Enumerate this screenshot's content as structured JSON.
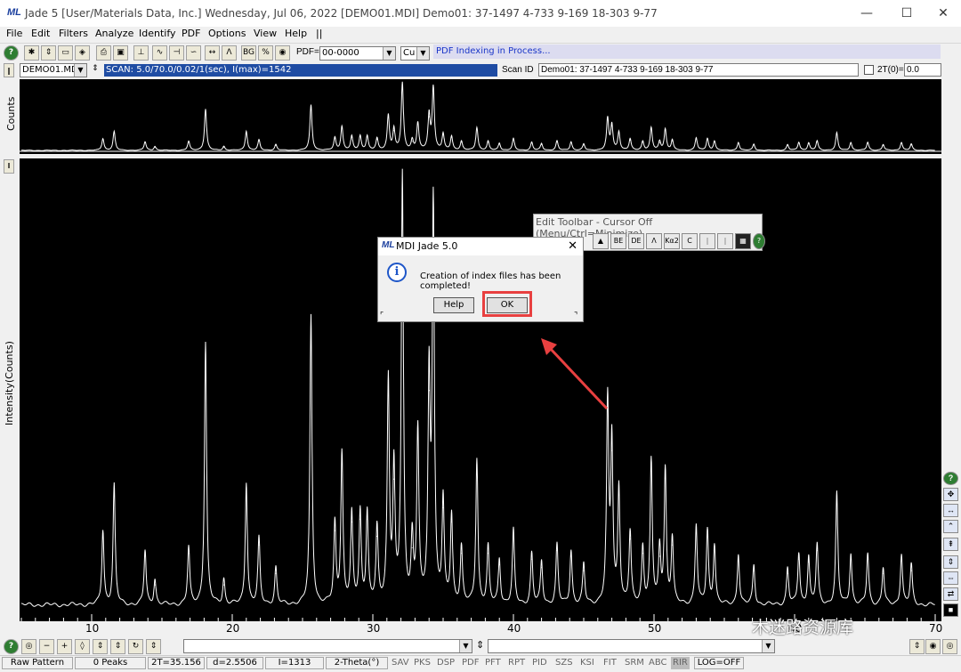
{
  "window": {
    "title": "Jade 5 [User/Materials Data, Inc.] Wednesday, Jul 06, 2022 [DEMO01.MDI] Demo01: 37-1497 4-733 9-169 18-303 9-77",
    "logo": "ML",
    "controls": {
      "minimize": "—",
      "maximize": "☐",
      "close": "✕"
    }
  },
  "menu": [
    "File",
    "Edit",
    "Filters",
    "Analyze",
    "Identify",
    "PDF",
    "Options",
    "View",
    "Help",
    "||"
  ],
  "toolbar": {
    "pdf_label": "PDF=",
    "pdf_value": "00-0000",
    "element_value": "Cu",
    "status": "PDF Indexing in Process..."
  },
  "scan": {
    "file": "DEMO01.MDI",
    "info": "SCAN: 5.0/70.0/0.02/1(sec), I(max)=1542",
    "id_label": "Scan ID",
    "id_value": "Demo01: 37-1497 4-733 9-169 18-303 9-77",
    "two_theta_label": "2T(0)=",
    "two_theta_value": "0.0"
  },
  "plot": {
    "top_ylabel": "Counts",
    "main_ylabel": "Intensity(Counts)",
    "x_ticks": [
      "10",
      "20",
      "30",
      "40",
      "50",
      "60",
      "70"
    ]
  },
  "edit_toolbar": {
    "title": "Edit Toolbar - Cursor Off (Menu/Ctrl=Minimize)",
    "buttons": [
      "BE",
      "DE",
      "Kα2",
      "C"
    ]
  },
  "dialog": {
    "title": "MDI Jade 5.0",
    "message": "Creation of index files has been completed!",
    "help_label": "Help",
    "ok_label": "OK",
    "close": "✕",
    "info_glyph": "i"
  },
  "statusbar": {
    "pattern": "Raw Pattern",
    "peaks": "0 Peaks",
    "two_theta": "2T=35.156",
    "d": "d=2.5506",
    "intensity": "I=1313",
    "mode": "2-Theta(°)",
    "buttons": [
      "SAV",
      "PKS",
      "DSP",
      "PDF",
      "PFT",
      "RPT",
      "PID",
      "SZS",
      "KSI",
      "FIT",
      "SRM",
      "ABC",
      "RIR"
    ],
    "log": "LOG=OFF"
  },
  "watermark": "木迷路资源库",
  "chart_data": {
    "type": "line",
    "xlabel": "",
    "ylabel": "Intensity(Counts)",
    "xlim": [
      4,
      70
    ],
    "ylim": [
      0,
      1542
    ],
    "peaks": [
      [
        10.8,
        260
      ],
      [
        11.6,
        420
      ],
      [
        13.8,
        190
      ],
      [
        14.5,
        90
      ],
      [
        16.9,
        200
      ],
      [
        18.1,
        920
      ],
      [
        19.4,
        90
      ],
      [
        21.0,
        430
      ],
      [
        21.9,
        230
      ],
      [
        23.1,
        130
      ],
      [
        25.6,
        1010
      ],
      [
        27.3,
        280
      ],
      [
        27.8,
        530
      ],
      [
        28.5,
        310
      ],
      [
        29.1,
        320
      ],
      [
        29.6,
        320
      ],
      [
        30.3,
        260
      ],
      [
        31.1,
        780
      ],
      [
        31.5,
        460
      ],
      [
        32.1,
        1490
      ],
      [
        32.8,
        220
      ],
      [
        33.2,
        600
      ],
      [
        34.0,
        770
      ],
      [
        34.3,
        1390
      ],
      [
        35.0,
        360
      ],
      [
        35.6,
        310
      ],
      [
        36.3,
        200
      ],
      [
        37.4,
        510
      ],
      [
        38.2,
        200
      ],
      [
        39.0,
        160
      ],
      [
        40.0,
        260
      ],
      [
        41.3,
        180
      ],
      [
        42.0,
        150
      ],
      [
        43.1,
        210
      ],
      [
        44.1,
        190
      ],
      [
        45.0,
        140
      ],
      [
        46.7,
        700
      ],
      [
        47.0,
        560
      ],
      [
        47.5,
        410
      ],
      [
        48.3,
        250
      ],
      [
        49.2,
        200
      ],
      [
        49.8,
        500
      ],
      [
        50.4,
        190
      ],
      [
        50.8,
        470
      ],
      [
        51.3,
        230
      ],
      [
        53.0,
        280
      ],
      [
        53.8,
        260
      ],
      [
        54.3,
        210
      ],
      [
        56.0,
        180
      ],
      [
        57.1,
        140
      ],
      [
        59.5,
        130
      ],
      [
        60.3,
        180
      ],
      [
        61.0,
        170
      ],
      [
        61.6,
        210
      ],
      [
        63.0,
        390
      ],
      [
        64.0,
        180
      ],
      [
        65.2,
        180
      ],
      [
        66.3,
        130
      ],
      [
        67.6,
        180
      ],
      [
        68.3,
        140
      ]
    ]
  }
}
